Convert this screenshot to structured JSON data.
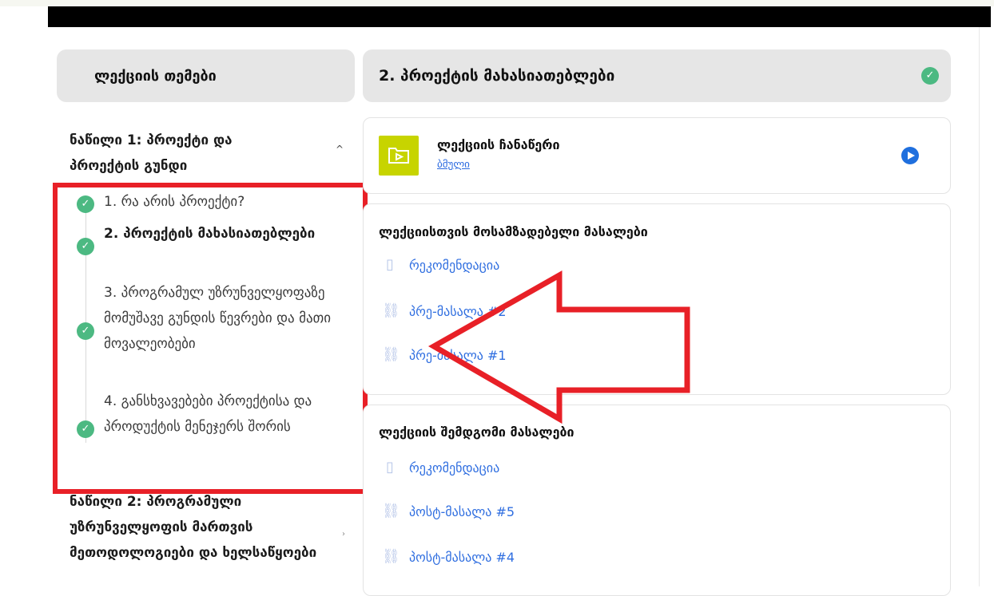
{
  "sidebar": {
    "header": "ლექციის თემები",
    "section1_title": "ნაწილი 1: პროექტი და პროექტის გუნდი",
    "lessons": [
      {
        "label": "1. რა არის პროექტი?",
        "done": true
      },
      {
        "label": "2. პროექტის მახასიათებლები",
        "done": true
      },
      {
        "label": "3. პროგრამულ უზრუნველყოფაზე მომუშავე გუნდის წევრები და მათი მოვალეობები",
        "done": true
      },
      {
        "label": "4. განსხვავებები პროექტისა და პროდუქტის მენეჯერს შორის",
        "done": true
      }
    ],
    "section2_title": "ნაწილი 2: პროგრამული უზრუნველყოფის მართვის მეთოდოლოგიები და ხელსაწყოები"
  },
  "main": {
    "title": "2. პროექტის მახასიათებლები",
    "video": {
      "title": "ლექციის ჩანაწერი",
      "link": "ბმული"
    },
    "pre_materials": {
      "title": "ლექციისთვის მოსამზადებელი მასალები",
      "items": [
        "რეკომენდაცია",
        "პრე-მასალა #2",
        "პრე-მასალა #1"
      ]
    },
    "post_materials": {
      "title": "ლექციის შემდგომი მასალები",
      "items": [
        "რეკომენდაცია",
        "პოსტ-მასალა #5",
        "პოსტ-მასალა #4"
      ]
    }
  },
  "colors": {
    "check": "#4cb982",
    "link": "#2f6ee0",
    "highlight": "#e82027",
    "thumb": "#c7d400"
  }
}
